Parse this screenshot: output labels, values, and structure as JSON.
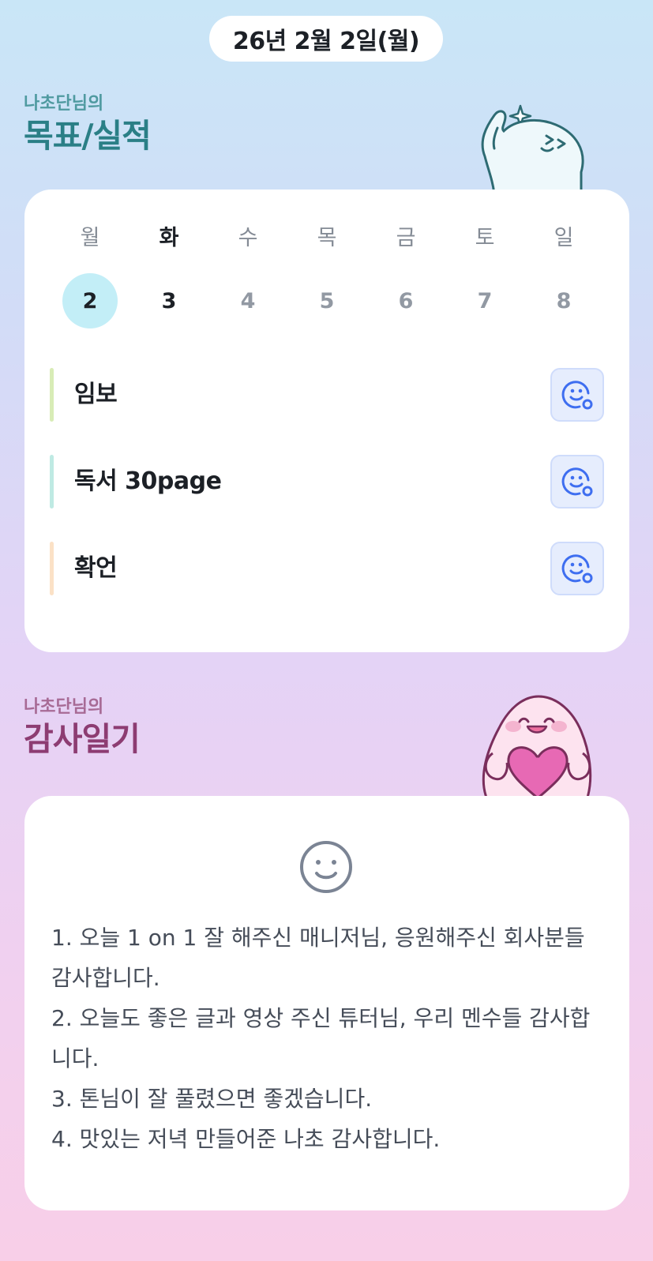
{
  "header": {
    "date": "26년 2월 2일(월)"
  },
  "goals_section": {
    "owner": "나초단님의",
    "title": "목표/실적"
  },
  "week": {
    "weekdays": [
      "월",
      "화",
      "수",
      "목",
      "금",
      "토",
      "일"
    ],
    "dates": [
      "2",
      "3",
      "4",
      "5",
      "6",
      "7",
      "8"
    ],
    "selected_index": 0,
    "today_index": 1
  },
  "goals": [
    {
      "label": "임보",
      "accent": "#d8ecb6",
      "icon": "smile-add-icon"
    },
    {
      "label": "독서 30page",
      "accent": "#bfeae3",
      "icon": "smile-add-icon"
    },
    {
      "label": "확언",
      "accent": "#fbe1c6",
      "icon": "smile-add-icon"
    }
  ],
  "thanks_section": {
    "owner": "나초단님의",
    "title": "감사일기"
  },
  "journal": {
    "icon": "smile-icon",
    "lines": [
      "1. 오늘 1 on 1 잘 해주신 매니저님, 응원해주신 회사분들 감사합니다.",
      "2. 오늘도 좋은 글과 영상 주신 튜터님, 우리 멘수들 감사합니다.",
      "3. 톤님이 잘 풀렸으면 좋겠습니다.",
      "4. 맛있는 저녁 만들어준 나초 감사합니다."
    ]
  },
  "colors": {
    "goals_title": "#2a7f86",
    "thanks_title": "#8d3c72",
    "selected_date_bg": "#c3eef7",
    "react_button_bg": "#e6edfd",
    "react_icon": "#3e6ef0"
  }
}
